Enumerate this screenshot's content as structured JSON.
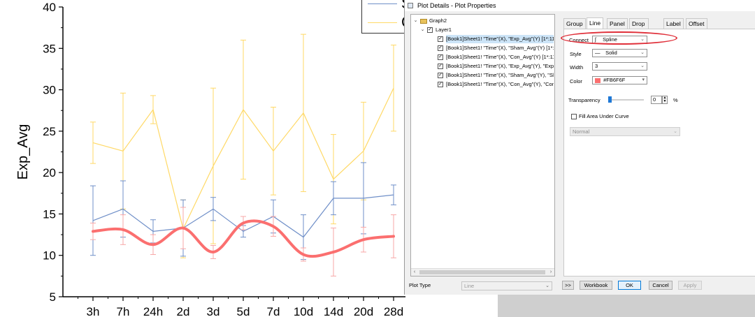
{
  "chart_data": {
    "type": "line",
    "categories": [
      "3h",
      "7h",
      "24h",
      "2d",
      "3d",
      "5d",
      "7d",
      "10d",
      "14d",
      "20d",
      "28d"
    ],
    "ylabel": "Exp_Avg",
    "xlabel": "",
    "ylim": [
      5,
      40
    ],
    "yticks": [
      5,
      10,
      15,
      20,
      25,
      30,
      35,
      40
    ],
    "series": [
      {
        "color": "#FFD966",
        "style": "line",
        "values": [
          23.6,
          22.6,
          27.6,
          13.2,
          20.8,
          27.6,
          22.6,
          27.2,
          19.2,
          22.6,
          30.2
        ],
        "error": [
          2.5,
          7.0,
          1.7,
          3.5,
          9.4,
          8.4,
          5.3,
          9.5,
          5.4,
          5.9,
          5.2
        ]
      },
      {
        "color": "#6F8FC8",
        "style": "line",
        "values": [
          14.2,
          15.6,
          12.9,
          13.3,
          15.6,
          12.9,
          14.7,
          12.2,
          16.9,
          16.9,
          17.3
        ],
        "error": [
          4.2,
          3.4,
          1.4,
          3.4,
          1.4,
          0.7,
          2.0,
          2.7,
          2.0,
          4.3,
          1.2
        ]
      },
      {
        "color": "#FB6F6F",
        "style": "spline",
        "values": [
          12.9,
          13.1,
          11.3,
          13.3,
          10.4,
          13.9,
          13.5,
          10.1,
          10.4,
          11.9,
          12.3
        ],
        "error": [
          1.0,
          1.8,
          1.2,
          2.5,
          0.8,
          0.8,
          1.2,
          0.8,
          2.9,
          1.5,
          2.6
        ]
      }
    ]
  },
  "legend": {
    "entries": [
      {
        "color": "#6F8FC8",
        "label": "S"
      },
      {
        "color": "#FFD966",
        "label": "C"
      }
    ]
  },
  "dialog": {
    "title": "Plot Details - Plot Properties",
    "tree": {
      "root": "Graph2",
      "layer": "Layer1",
      "items": [
        "[Book1]Sheet1! \"Time\"(X), \"Exp_Avg\"(Y) [1*:11",
        "[Book1]Sheet1! \"Time\"(X), \"Sham_Avg\"(Y) [1*:1",
        "[Book1]Sheet1! \"Time\"(X), \"Con_Avg\"(Y) [1*:11",
        "[Book1]Sheet1! \"Time\"(X), \"Exp_Avg\"(Y), \"Exp_",
        "[Book1]Sheet1! \"Time\"(X), \"Sham_Avg\"(Y), \"Sh",
        "[Book1]Sheet1! \"Time\"(X), \"Con_Avg\"(Y), \"Con"
      ]
    },
    "plot_type_label": "Plot Type",
    "plot_type_value": "Line",
    "tabs": [
      "Group",
      "Line",
      "Panel",
      "Drop Lines",
      "Label",
      "Offset"
    ],
    "active_tab": "Line",
    "line_tab": {
      "connect_label": "Connect",
      "connect_value": "Spline",
      "style_label": "Style",
      "style_value": "Solid",
      "width_label": "Width",
      "width_value": "3",
      "color_label": "Color",
      "color_value": "#FB6F6F",
      "color_swatch": "#FB6F6F",
      "transparency_label": "Transparency",
      "transparency_value": "0",
      "transparency_unit": "%",
      "fill_area_label": "Fill Area Under Curve",
      "fill_mode_value": "Normal"
    },
    "buttons": {
      "expand": ">>",
      "workbook": "Workbook",
      "ok": "OK",
      "cancel": "Cancel",
      "apply": "Apply"
    }
  }
}
